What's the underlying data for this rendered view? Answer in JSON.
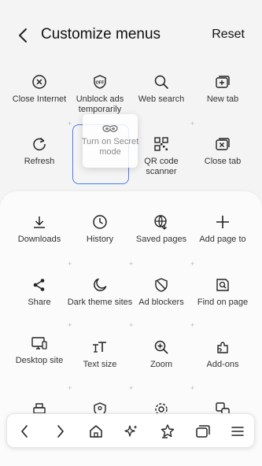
{
  "header": {
    "title": "Customize menus",
    "reset_label": "Reset"
  },
  "top_grid": [
    {
      "label": "Close Internet",
      "icon": "close-circle-icon"
    },
    {
      "label": "Unblock ads temporarily",
      "icon": "ad-off-icon"
    },
    {
      "label": "Web search",
      "icon": "search-icon"
    },
    {
      "label": "New tab",
      "icon": "new-tab-icon"
    },
    {
      "label": "Refresh",
      "icon": "refresh-icon"
    },
    {
      "label": "QR code scanner",
      "icon": "qr-code-icon"
    },
    {
      "label": "Close tab",
      "icon": "close-tab-icon"
    }
  ],
  "dragged_item": {
    "label": "Turn on Secret mode",
    "icon": "secret-mode-icon"
  },
  "panel_grid": [
    {
      "label": "Downloads",
      "icon": "download-icon"
    },
    {
      "label": "History",
      "icon": "history-icon"
    },
    {
      "label": "Saved pages",
      "icon": "saved-pages-icon"
    },
    {
      "label": "Add page to",
      "icon": "plus-icon"
    },
    {
      "label": "Share",
      "icon": "share-icon"
    },
    {
      "label": "Dark theme sites",
      "icon": "moon-icon"
    },
    {
      "label": "Ad blockers",
      "icon": "shield-block-icon"
    },
    {
      "label": "Find on page",
      "icon": "find-on-page-icon"
    },
    {
      "label": "Desktop site",
      "icon": "desktop-icon"
    },
    {
      "label": "Text size",
      "icon": "text-size-icon"
    },
    {
      "label": "Zoom",
      "icon": "zoom-in-icon"
    },
    {
      "label": "Add-ons",
      "icon": "puzzle-icon"
    }
  ],
  "bottom_bar": [
    "back-icon",
    "forward-icon",
    "home-icon",
    "sparkle-icon",
    "bookmark-star-icon",
    "tabs-icon",
    "menu-icon"
  ]
}
